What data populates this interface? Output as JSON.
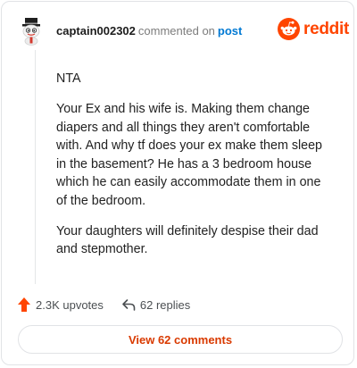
{
  "header": {
    "username": "captain002302",
    "commented_text": "commented on",
    "post_link": "post",
    "brand": "reddit"
  },
  "comment": {
    "paragraphs": [
      "NTA",
      "Your Ex and his wife is. Making them change diapers and all things they aren't comfortable with. And why tf does your ex make them sleep in the basement? He has a 3 bedroom house which he can easily accommodate them in one of the bedroom.",
      "Your daughters will definitely despise their dad and stepmother."
    ]
  },
  "actions": {
    "upvotes_label": "2.3K upvotes",
    "replies_label": "62 replies"
  },
  "view_comments_label": "View 62 comments",
  "colors": {
    "brand": "#ff4500",
    "link": "#0079d3",
    "view_button_text": "#d93a00"
  },
  "icons": {
    "avatar": "snoo-avatar-icon",
    "brand_logo": "reddit-snoo-icon",
    "upvote": "upvote-arrow-icon",
    "reply": "reply-arrow-icon"
  }
}
